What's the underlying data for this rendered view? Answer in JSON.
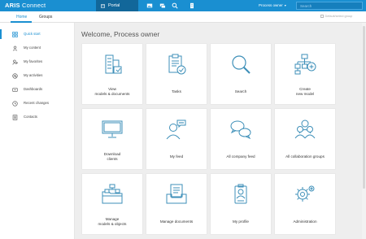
{
  "topbar": {
    "brand_bold": "ARIS",
    "brand_light": " Connect",
    "portal_label": "Portal",
    "user_label": "Process owner",
    "search_placeholder": "Search"
  },
  "tabs": [
    {
      "label": "Home",
      "active": true
    },
    {
      "label": "Groups",
      "active": false
    }
  ],
  "selector_label": "Default/select group",
  "sidebar": {
    "items": [
      {
        "label": "Quick start",
        "icon": "grid-icon",
        "active": true
      },
      {
        "label": "My content",
        "icon": "user-icon",
        "active": false
      },
      {
        "label": "My favorites",
        "icon": "heart-user-icon",
        "active": false
      },
      {
        "label": "My activities",
        "icon": "activity-icon",
        "active": false
      },
      {
        "label": "Dashboards",
        "icon": "dashboard-icon",
        "active": false
      },
      {
        "label": "Recent changes",
        "icon": "clock-icon",
        "active": false
      },
      {
        "label": "Contacts",
        "icon": "contacts-icon",
        "active": false
      }
    ]
  },
  "welcome": "Welcome, Process owner",
  "tiles": [
    {
      "label": "View\nmodels & documents",
      "icon": "building-icon"
    },
    {
      "label": "Tasks",
      "icon": "clipboard-check-icon"
    },
    {
      "label": "Search",
      "icon": "magnifier-icon"
    },
    {
      "label": "Create\nnew model",
      "icon": "hierarchy-plus-icon"
    },
    {
      "label": "Download\nclients",
      "icon": "monitor-icon"
    },
    {
      "label": "My feed",
      "icon": "person-chat-icon"
    },
    {
      "label": "All company feed",
      "icon": "chat-bubbles-icon"
    },
    {
      "label": "All collaboration groups",
      "icon": "group-icon"
    },
    {
      "label": "Manage\nmodels & objects",
      "icon": "folder-models-icon"
    },
    {
      "label": "Manage documents",
      "icon": "document-tray-icon"
    },
    {
      "label": "My profile",
      "icon": "badge-icon"
    },
    {
      "label": "Administration",
      "icon": "gears-icon"
    }
  ],
  "colors": {
    "accent": "#1a8fd1",
    "topbar": "#1a8fd1",
    "portal": "#12679a",
    "icon_stroke": "#3d8fb8",
    "content_bg": "#eeeeee"
  }
}
